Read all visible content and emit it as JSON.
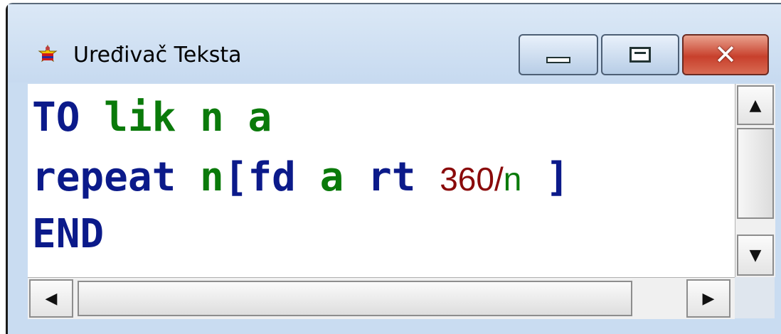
{
  "window": {
    "title": "Uređivač Teksta",
    "icon": "turtle-icon",
    "buttons": {
      "minimize": "minimize-icon",
      "maximize": "maximize-icon",
      "close": "close-icon",
      "close_glyph": "✕"
    }
  },
  "editor": {
    "line1": {
      "kw": "TO",
      "name": "lik",
      "arg1": "n",
      "arg2": "a"
    },
    "line2": {
      "cmd": "repeat",
      "count": "n",
      "open": "[",
      "fd": "fd",
      "fd_arg": "a",
      "rt": "rt",
      "num": "360/",
      "num_var": "n",
      "close": "]"
    },
    "line3": {
      "kw": "END"
    }
  },
  "scrollbars": {
    "up_glyph": "▲",
    "down_glyph": "▼",
    "left_glyph": "◀",
    "right_glyph": "▶"
  },
  "colors": {
    "keyword": "#0b1a8a",
    "name": "#0a7a0a",
    "number": "#8a0a0a",
    "close_button": "#c8402c"
  }
}
